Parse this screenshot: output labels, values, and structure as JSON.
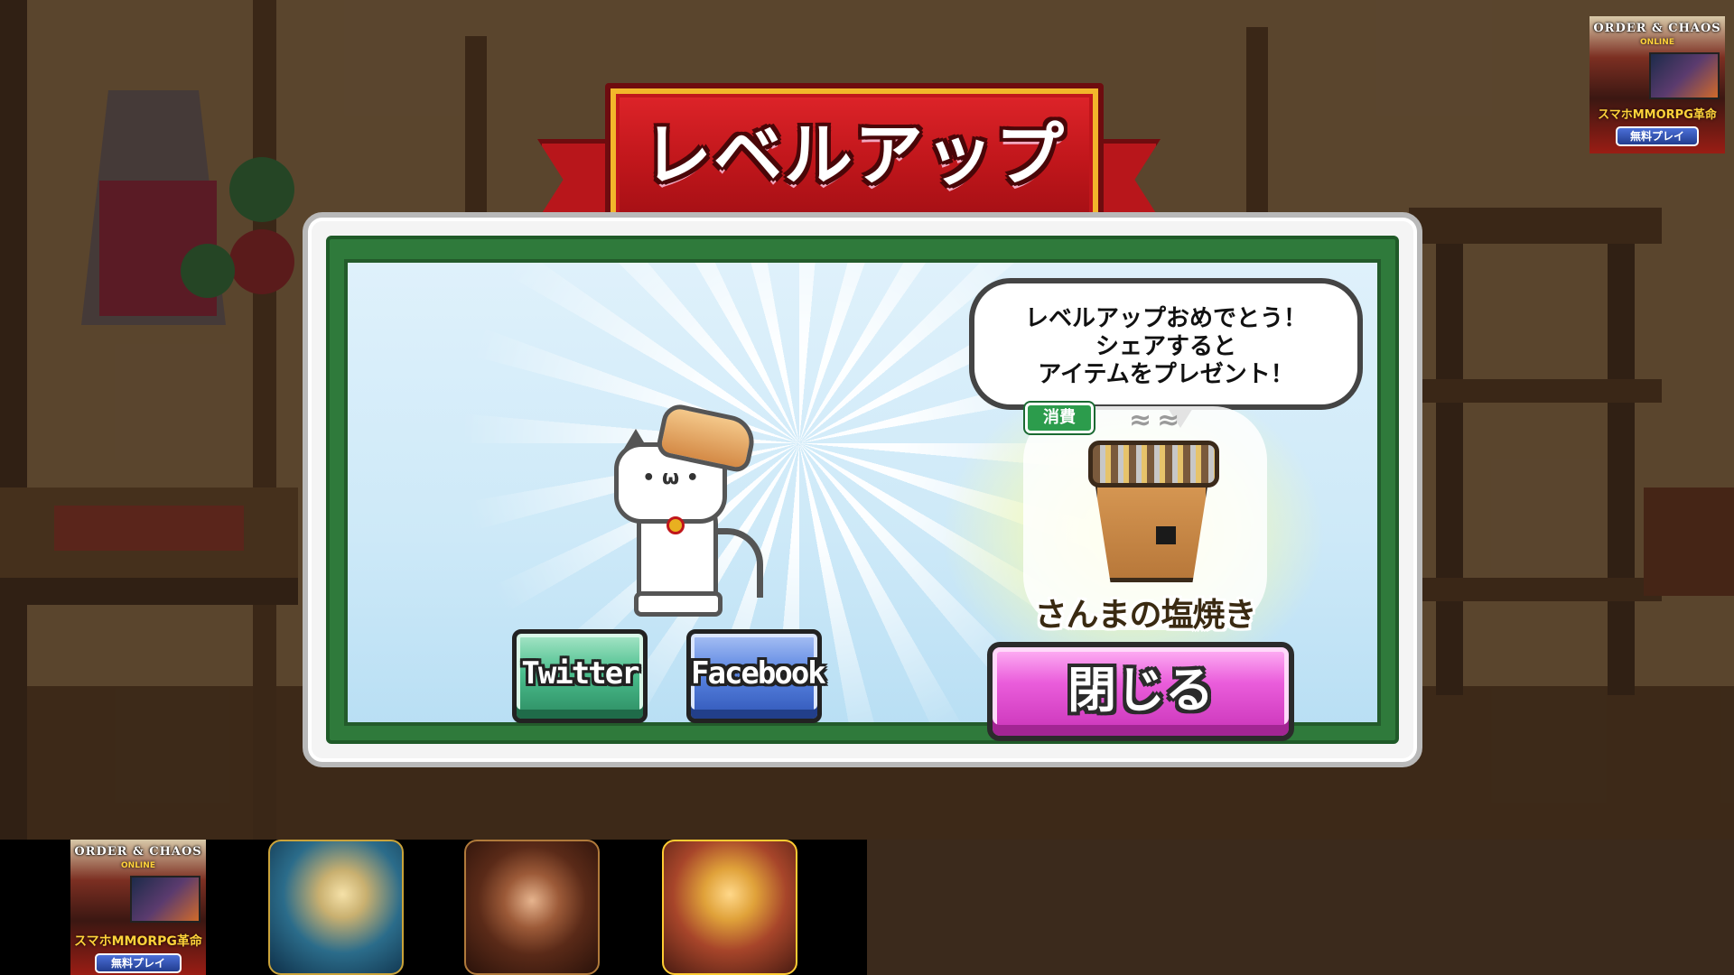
{
  "dialog": {
    "title": "レベルアップ",
    "bubble_lines": [
      "レベルアップおめでとう！",
      "シェアすると",
      "アイテムをプレゼント！"
    ],
    "consume_badge": "消費",
    "item_name": "さんまの塩焼き",
    "twitter_label": "Twitter",
    "facebook_label": "Facebook",
    "close_label": "閉じる"
  },
  "ads": {
    "top_right": {
      "title": "ORDER & CHAOS",
      "subtitle": "ONLINE",
      "tagline": "スマホMMORPG革命",
      "button": "無料プレイ"
    },
    "bottom": [
      {
        "title": "ORDER & CHAOS",
        "subtitle": "ONLINE",
        "tagline": "スマホMMORPG革命",
        "button": "無料プレイ"
      },
      {
        "icon": "anime-knight-app-icon"
      },
      {
        "icon": "survivor-woman-app-icon"
      },
      {
        "icon": "samurai-warrior-app-icon"
      }
    ]
  },
  "colors": {
    "ribbon_red": "#c0161b",
    "twitter_green": "#4cbf8e",
    "facebook_blue": "#5b86e2",
    "close_pink": "#ea5ddb",
    "panel_green": "#2f7a3b"
  }
}
